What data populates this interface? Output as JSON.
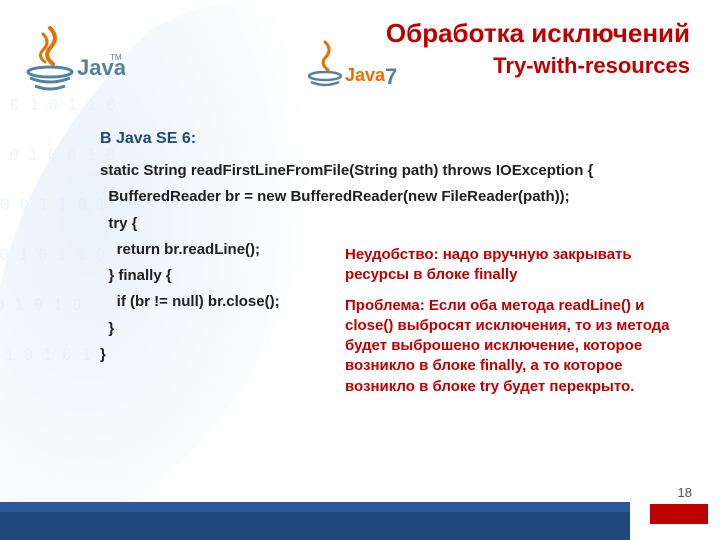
{
  "header": {
    "title": "Обработка исключений",
    "subtitle": "Try-with-resources"
  },
  "logos": {
    "java_text": "Java",
    "java7_text": "Java",
    "java7_version": "7"
  },
  "content": {
    "heading": "В Java SE 6:",
    "code_lines": [
      "static String readFirstLineFromFile(String path) throws IOException {",
      "  BufferedReader br = new BufferedReader(new FileReader(path));",
      "  try {",
      "    return br.readLine();",
      "  } finally {",
      "    if (br != null) br.close();",
      "  }",
      "}"
    ]
  },
  "notes": {
    "p1": "Неудобство: надо вручную закрывать ресурсы в блоке finally",
    "p2": "Проблема: Если оба метода readLine() и close() выбросят исключения, то из метода будет выброшено исключение, которое возникло в блоке finally, а то которое возникло в блоке try будет перекрыто."
  },
  "footer": {
    "page": "18"
  }
}
